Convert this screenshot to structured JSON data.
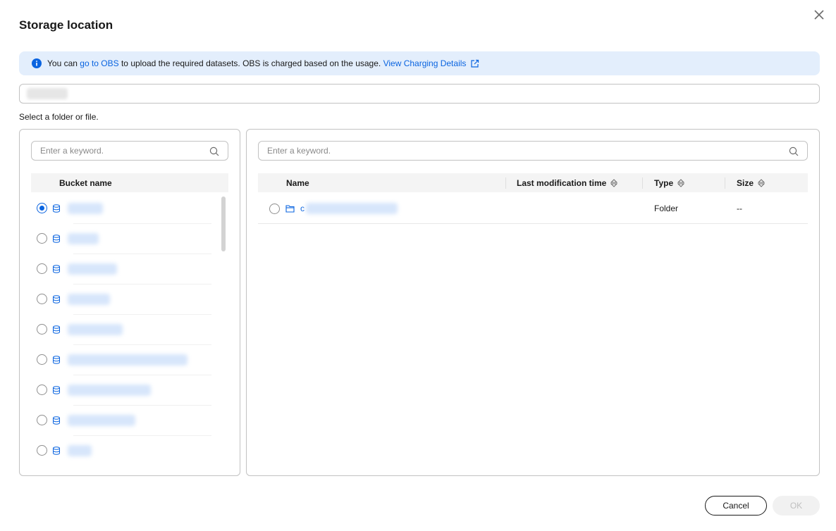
{
  "dialog": {
    "title": "Storage location"
  },
  "notice": {
    "prefix": "You can ",
    "obs_link": "go to OBS",
    "middle": " to upload the required datasets. OBS is charged based on the usage. ",
    "charging_link": "View Charging Details"
  },
  "hint": "Select a folder or file.",
  "left_panel": {
    "search_placeholder": "Enter a keyword.",
    "column_header": "Bucket name",
    "selected_index": 0
  },
  "right_panel": {
    "search_placeholder": "Enter a keyword.",
    "columns": {
      "name": "Name",
      "last_modified": "Last modification time",
      "type": "Type",
      "size": "Size"
    },
    "rows": [
      {
        "name_visible": "c",
        "type": "Folder",
        "size": "--"
      }
    ]
  },
  "footer": {
    "cancel": "Cancel",
    "ok": "OK"
  },
  "colors": {
    "accent": "#0a64e0",
    "notice_bg": "#e3eefc",
    "header_bg": "#f4f4f4"
  }
}
